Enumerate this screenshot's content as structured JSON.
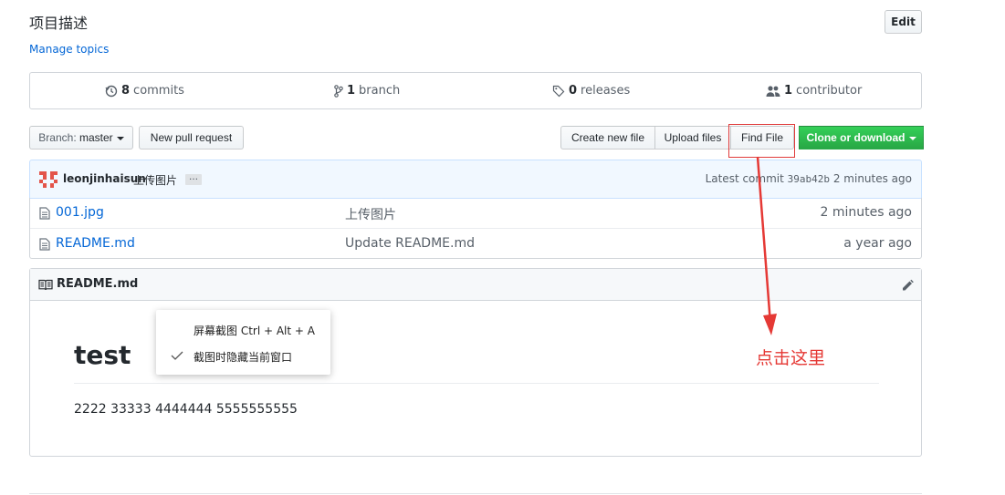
{
  "repo": {
    "description": "项目描述",
    "manage_topics": "Manage topics",
    "edit_label": "Edit"
  },
  "summary": {
    "commits_count": "8",
    "commits_label": "commits",
    "branch_count": "1",
    "branch_label": "branch",
    "releases_count": "0",
    "releases_label": "releases",
    "contributor_count": "1",
    "contributor_label": "contributor"
  },
  "toolbar": {
    "branch_prefix": "Branch:",
    "branch_name": "master",
    "new_pull_request": "New pull request",
    "create_new_file": "Create new file",
    "upload_files": "Upload files",
    "find_file": "Find File",
    "clone_download": "Clone or download"
  },
  "latest_commit": {
    "author": "leonjinhaisun",
    "message": "上传图片",
    "ellipsis": "…",
    "label": "Latest commit",
    "sha": "39ab42b",
    "time": "2 minutes ago"
  },
  "files": [
    {
      "name": "001.jpg",
      "message": "上传图片",
      "age": "2 minutes ago"
    },
    {
      "name": "README.md",
      "message": "Update README.md",
      "age": "a year ago"
    }
  ],
  "readme": {
    "title": "README.md",
    "heading": "test",
    "body": "2222 33333 4444444 5555555555"
  },
  "screenshot_menu": {
    "items": [
      {
        "label": "屏幕截图 Ctrl + Alt + A",
        "checked": false
      },
      {
        "label": "截图时隐藏当前窗口",
        "checked": true
      }
    ]
  },
  "annotation": {
    "text": "点击这里",
    "color": "#e53935"
  },
  "colors": {
    "link": "#0366d6",
    "green": "#28a745",
    "commit_bar_bg": "#f1f8ff"
  }
}
